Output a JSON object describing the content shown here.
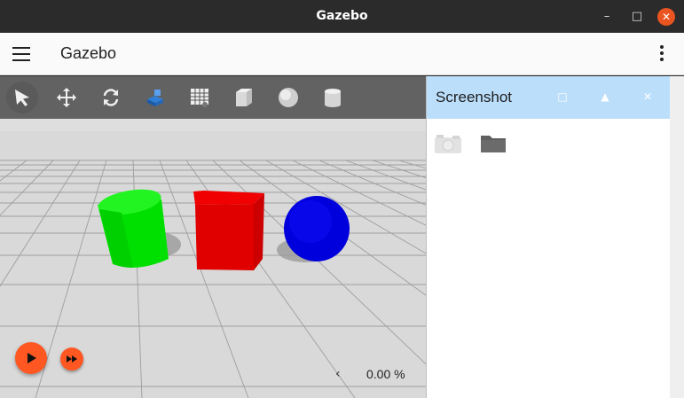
{
  "window": {
    "title": "Gazebo",
    "minimize_glyph": "–",
    "maximize_glyph": "□",
    "close_glyph": "✕"
  },
  "appbar": {
    "title": "Gazebo"
  },
  "toolbar": {
    "tools": [
      {
        "name": "select",
        "icon": "arrow-cursor-icon"
      },
      {
        "name": "translate",
        "icon": "move-arrows-icon"
      },
      {
        "name": "rotate",
        "icon": "rotate-icon"
      },
      {
        "name": "transform-control",
        "icon": "transform-control-icon"
      },
      {
        "name": "grid-config",
        "icon": "grid-icon"
      },
      {
        "name": "box",
        "icon": "box-icon"
      },
      {
        "name": "sphere",
        "icon": "sphere-icon"
      },
      {
        "name": "cylinder",
        "icon": "cylinder-icon"
      }
    ]
  },
  "scene": {
    "models": [
      {
        "shape": "cylinder",
        "color": "#00e000"
      },
      {
        "shape": "box",
        "color": "#e00000"
      },
      {
        "shape": "sphere",
        "color": "#0000e0"
      }
    ]
  },
  "playback": {
    "play_icon": "play-icon",
    "step_icon": "fast-forward-icon",
    "collapse_glyph": "‹",
    "real_time_factor": "0.00 %"
  },
  "panel": {
    "title": "Screenshot",
    "float_glyph": "□",
    "collapse_glyph": "▲",
    "close_glyph": "✕",
    "header_color": "#bbdefb"
  },
  "colors": {
    "accent": "#ff5722",
    "window_close": "#e95420"
  }
}
